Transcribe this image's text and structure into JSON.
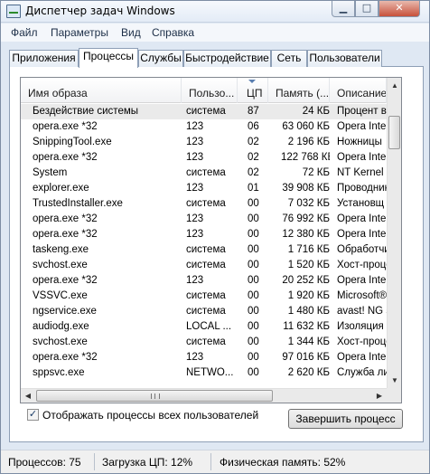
{
  "window": {
    "title": "Диспетчер задач Windows",
    "minimize_glyph": "▁",
    "maximize_glyph": "□",
    "close_glyph": "✕"
  },
  "menu": [
    "Файл",
    "Параметры",
    "Вид",
    "Справка"
  ],
  "tabs": [
    "Приложения",
    "Процессы",
    "Службы",
    "Быстродействие",
    "Сеть",
    "Пользователи"
  ],
  "active_tab": "Процессы",
  "columns": [
    "Имя образа",
    "Пользо...",
    "ЦП",
    "Память (...",
    "Описание"
  ],
  "sort_column": "ЦП",
  "rows": [
    {
      "name": "Бездействие системы",
      "user": "система",
      "cpu": "87",
      "mem": "24 КБ",
      "desc": "Процент вр"
    },
    {
      "name": "opera.exe *32",
      "user": "123",
      "cpu": "06",
      "mem": "63 060 КБ",
      "desc": "Opera Inter"
    },
    {
      "name": "SnippingTool.exe",
      "user": "123",
      "cpu": "02",
      "mem": "2 196 КБ",
      "desc": "Ножницы"
    },
    {
      "name": "opera.exe *32",
      "user": "123",
      "cpu": "02",
      "mem": "122 768 КБ",
      "desc": "Opera Inter"
    },
    {
      "name": "System",
      "user": "система",
      "cpu": "02",
      "mem": "72 КБ",
      "desc": "NT Kernel &"
    },
    {
      "name": "explorer.exe",
      "user": "123",
      "cpu": "01",
      "mem": "39 908 КБ",
      "desc": "Проводник"
    },
    {
      "name": "TrustedInstaller.exe",
      "user": "система",
      "cpu": "00",
      "mem": "7 032 КБ",
      "desc": "Установщ"
    },
    {
      "name": "opera.exe *32",
      "user": "123",
      "cpu": "00",
      "mem": "76 992 КБ",
      "desc": "Opera Inter"
    },
    {
      "name": "opera.exe *32",
      "user": "123",
      "cpu": "00",
      "mem": "12 380 КБ",
      "desc": "Opera Inter"
    },
    {
      "name": "taskeng.exe",
      "user": "система",
      "cpu": "00",
      "mem": "1 716 КБ",
      "desc": "Обработчи"
    },
    {
      "name": "svchost.exe",
      "user": "система",
      "cpu": "00",
      "mem": "1 520 КБ",
      "desc": "Хост-проце"
    },
    {
      "name": "opera.exe *32",
      "user": "123",
      "cpu": "00",
      "mem": "20 252 КБ",
      "desc": "Opera Inter"
    },
    {
      "name": "VSSVC.exe",
      "user": "система",
      "cpu": "00",
      "mem": "1 920 КБ",
      "desc": "Microsoft®"
    },
    {
      "name": "ngservice.exe",
      "user": "система",
      "cpu": "00",
      "mem": "1 480 КБ",
      "desc": "avast! NG s"
    },
    {
      "name": "audiodg.exe",
      "user": "LOCAL ...",
      "cpu": "00",
      "mem": "11 632 КБ",
      "desc": "Изоляция г"
    },
    {
      "name": "svchost.exe",
      "user": "система",
      "cpu": "00",
      "mem": "1 344 КБ",
      "desc": "Хост-проце"
    },
    {
      "name": "opera.exe *32",
      "user": "123",
      "cpu": "00",
      "mem": "97 016 КБ",
      "desc": "Opera Inter"
    },
    {
      "name": "sppsvc.exe",
      "user": "NETWO...",
      "cpu": "00",
      "mem": "2 620 КБ",
      "desc": "Служба ли"
    }
  ],
  "selected_row": "Бездействие системы",
  "show_all_users": {
    "checked": true,
    "label": "Отображать процессы всех пользователей"
  },
  "end_process_label": "Завершить процесс",
  "status": {
    "processes": "Процессов: 75",
    "cpu": "Загрузка ЦП: 12%",
    "memory": "Физическая память: 52%"
  },
  "icons": {
    "app": "task-manager-icon",
    "scroll_up": "▲",
    "scroll_down": "▼",
    "scroll_left": "◀",
    "scroll_right": "▶",
    "check": "✓"
  }
}
